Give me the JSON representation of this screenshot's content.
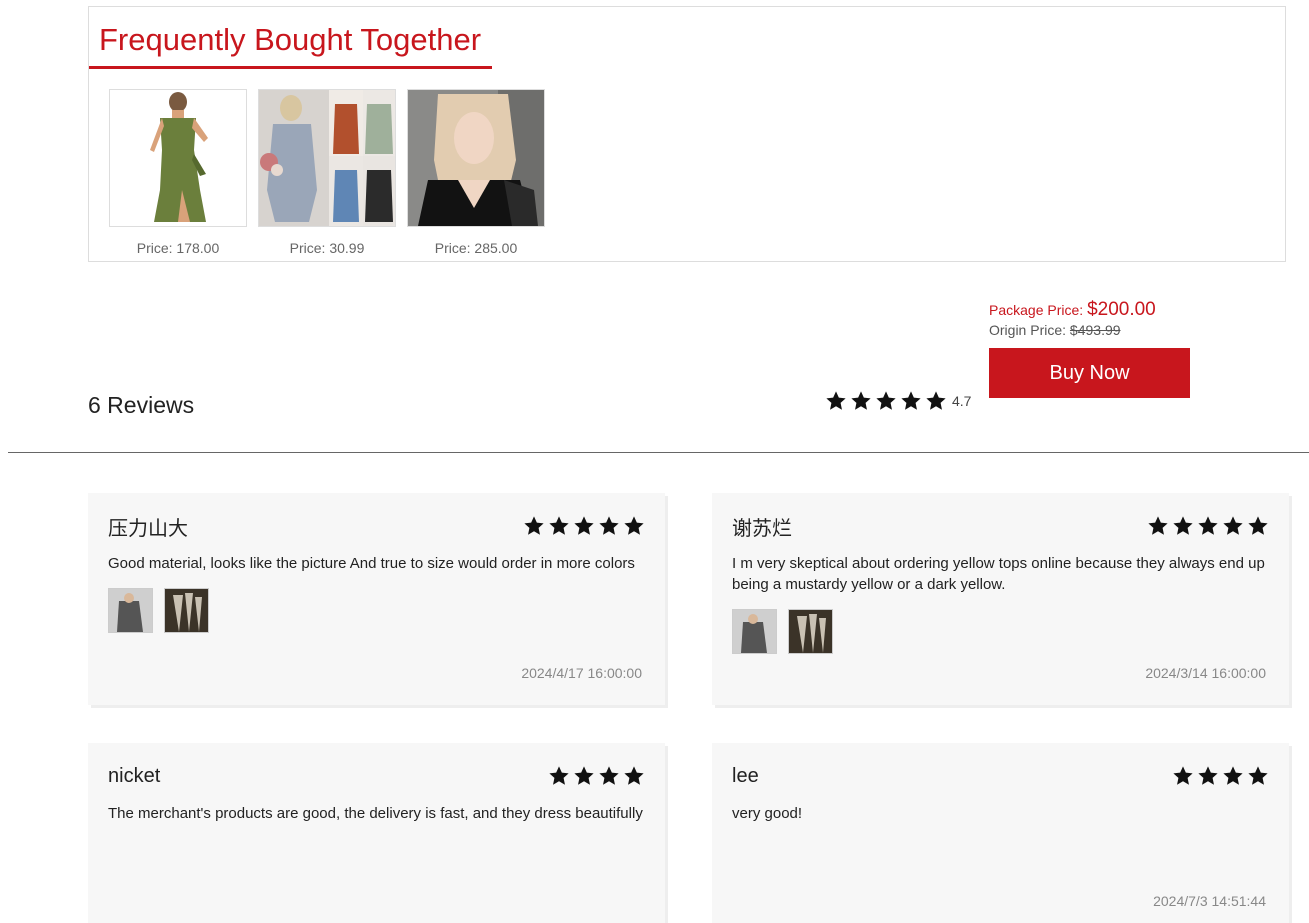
{
  "fbt": {
    "title": "Frequently Bought Together",
    "items": [
      {
        "price": "Price: 178.00"
      },
      {
        "price": "Price: 30.99"
      },
      {
        "price": "Price: 285.00"
      }
    ]
  },
  "package": {
    "package_label": "Package Price:",
    "package_price": "$200.00",
    "origin_label": "Origin Price:",
    "origin_price": "$493.99",
    "buy_label": "Buy Now",
    "accent_color": "#c8161d"
  },
  "reviews_summary": {
    "heading": "6 Reviews",
    "rating": "4.7",
    "stars": 5
  },
  "reviews": [
    {
      "name": "压力山大",
      "stars": 5,
      "text": "Good material, looks like the picture And true to size would order in more colors",
      "date": "2024/4/17 16:00:00"
    },
    {
      "name": "谢苏烂",
      "stars": 5,
      "text": "I m very skeptical about ordering yellow tops online because they always end up being a mustardy yellow or a dark yellow.",
      "date": "2024/3/14 16:00:00"
    },
    {
      "name": "nicket",
      "stars": 4,
      "text": "The merchant's products are good, the delivery is fast, and they dress beautifully",
      "date": ""
    },
    {
      "name": "lee",
      "stars": 4,
      "text": "very good!",
      "date": "2024/7/3 14:51:44"
    }
  ]
}
